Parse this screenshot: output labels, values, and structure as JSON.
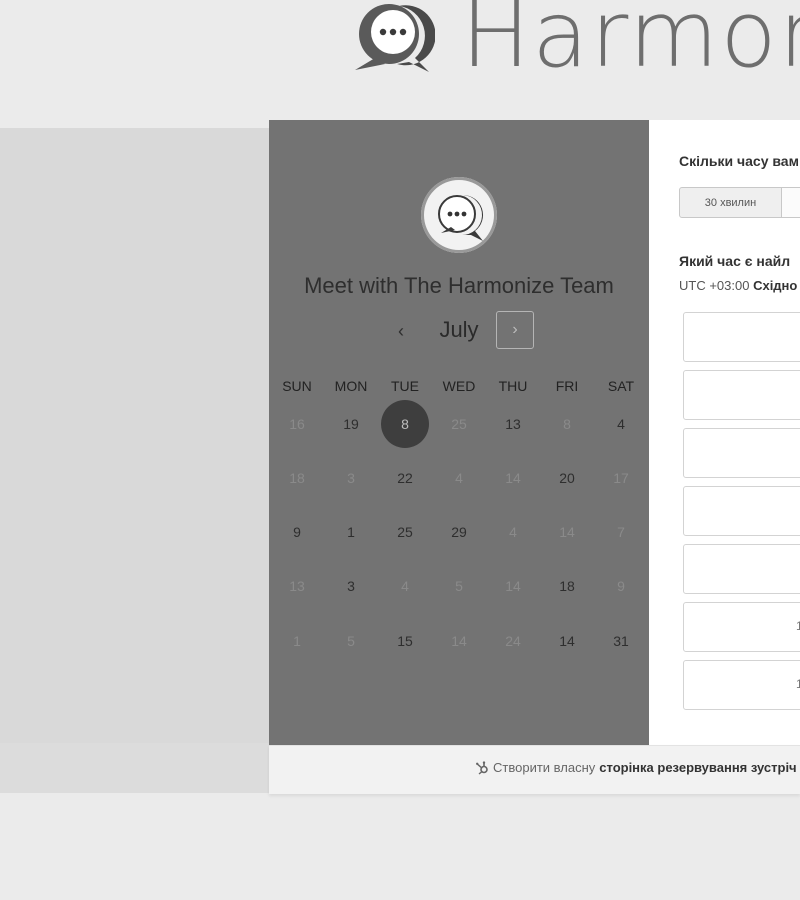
{
  "brand": {
    "name": "Harmon"
  },
  "calendar": {
    "title": "Meet with The Harmonize Team",
    "month": "July",
    "prev_label": "‹",
    "next_label": "›",
    "weekdays": [
      "SUN",
      "MON",
      "TUE",
      "WED",
      "THU",
      "FRI",
      "SAT"
    ],
    "weeks": [
      [
        {
          "d": "16",
          "s": "dim"
        },
        {
          "d": "19",
          "s": "active"
        },
        {
          "d": "8",
          "s": "selected"
        },
        {
          "d": "25",
          "s": "dim"
        },
        {
          "d": "13",
          "s": "active"
        },
        {
          "d": "8",
          "s": "dim"
        },
        {
          "d": "4",
          "s": "active"
        }
      ],
      [
        {
          "d": "18",
          "s": "dim"
        },
        {
          "d": "3",
          "s": "dim"
        },
        {
          "d": "22",
          "s": "active"
        },
        {
          "d": "4",
          "s": "dim"
        },
        {
          "d": "14",
          "s": "dim"
        },
        {
          "d": "20",
          "s": "active"
        },
        {
          "d": "17",
          "s": "dim"
        }
      ],
      [
        {
          "d": "9",
          "s": "active"
        },
        {
          "d": "1",
          "s": "active"
        },
        {
          "d": "25",
          "s": "active"
        },
        {
          "d": "29",
          "s": "active"
        },
        {
          "d": "4",
          "s": "dim"
        },
        {
          "d": "14",
          "s": "dim"
        },
        {
          "d": "7",
          "s": "dim"
        }
      ],
      [
        {
          "d": "13",
          "s": "dim"
        },
        {
          "d": "3",
          "s": "active"
        },
        {
          "d": "4",
          "s": "dim"
        },
        {
          "d": "5",
          "s": "dim"
        },
        {
          "d": "14",
          "s": "dim"
        },
        {
          "d": "18",
          "s": "active"
        },
        {
          "d": "9",
          "s": "dim"
        }
      ],
      [
        {
          "d": "1",
          "s": "dim"
        },
        {
          "d": "5",
          "s": "dim"
        },
        {
          "d": "15",
          "s": "active"
        },
        {
          "d": "14",
          "s": "dim"
        },
        {
          "d": "24",
          "s": "dim"
        },
        {
          "d": "14",
          "s": "active"
        },
        {
          "d": "31",
          "s": "active"
        }
      ]
    ]
  },
  "booking": {
    "duration_question": "Скільки часу вам",
    "durations": [
      "30 хвилин",
      ""
    ],
    "time_question": "Який час є найл",
    "timezone_offset": "UTC +03:00",
    "timezone_name": "Східно",
    "slot_marks": [
      "",
      "",
      "",
      "",
      "",
      "1",
      "1"
    ]
  },
  "footer": {
    "prefix": "Створити власну",
    "link": "сторінка резервування зустріч"
  },
  "colors": {
    "calendar_bg": "#737373",
    "selected_day": "#3e3e3e",
    "page_bg": "#ebebeb"
  }
}
